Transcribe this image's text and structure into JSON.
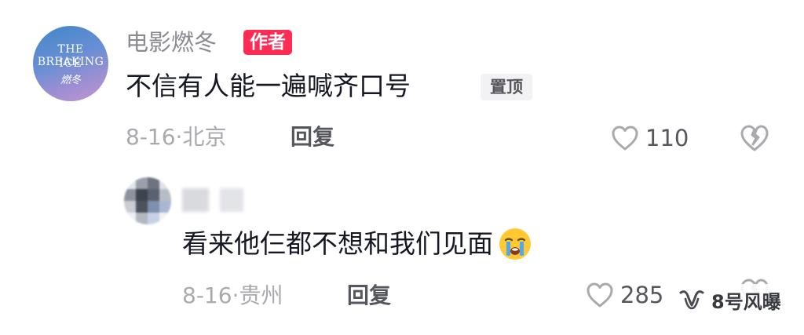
{
  "comment": {
    "avatar_text": {
      "line1": "THE BREAKING",
      "line2": "ICE",
      "line3": "燃冬"
    },
    "username": "电影燃冬",
    "author_badge": "作者",
    "text": "不信有人能一遍喊齐口号",
    "pin_badge": "置顶",
    "date": "8-16",
    "separator": "·",
    "location": "北京",
    "reply_label": "回复",
    "like_count": "110",
    "icons": {
      "like": "heart-outline-icon",
      "dislike": "broken-heart-icon"
    }
  },
  "reply": {
    "username_blurred": true,
    "text": "看来他仨都不想和我们见面",
    "emoji": "loudly-crying-face",
    "date": "8-16",
    "separator": "·",
    "location": "贵州",
    "reply_label": "回复",
    "like_count": "285",
    "icons": {
      "like": "heart-outline-icon",
      "dislike": "broken-heart-icon"
    }
  },
  "watermark": {
    "text": "8号风曝",
    "icon": "wechat-channel-icon"
  },
  "colors": {
    "author_badge": "#fe2c55",
    "pin_badge_bg": "#f2f2f4",
    "meta": "#a9aaad",
    "text": "#161823"
  }
}
